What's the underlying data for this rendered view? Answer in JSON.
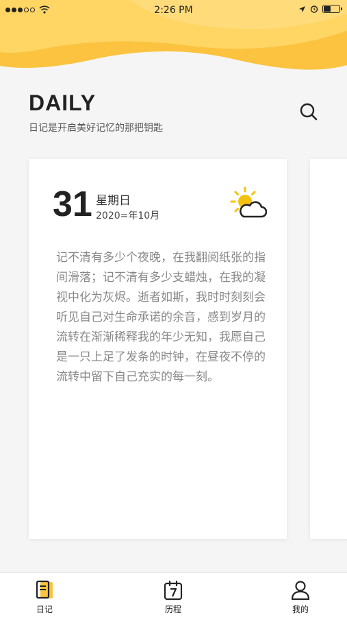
{
  "status_bar": {
    "time": "2:26 PM",
    "icons": [
      "signal-dots",
      "wifi-icon",
      "location-icon",
      "alarm-icon",
      "battery-icon"
    ]
  },
  "header": {
    "title": "DAILY",
    "subtitle": "日记是开启美好记忆的那把钥匙",
    "search_icon": "search-icon"
  },
  "colors": {
    "accent": "#fbc33f",
    "accent_light": "#ffd86a",
    "background": "#f5f5f5",
    "card": "#ffffff",
    "body_text": "#888888"
  },
  "entry": {
    "day": "31",
    "weekday": "星期日",
    "date": "2020=年10月",
    "weather_icon": "partly-cloudy-icon",
    "text": "记不清有多少个夜晚，在我翻阅纸张的指间滑落；记不清有多少支蜡烛，在我的凝视中化为灰烬。逝者如斯，我时时刻刻会听见自己对生命承诺的余音，感到岁月的流转在渐渐稀释我的年少无知，我愿自己是一只上足了发条的时钟，在昼夜不停的流转中留下自己充实的每一刻。"
  },
  "tabs": [
    {
      "label": "日记",
      "icon": "diary-icon"
    },
    {
      "label": "历程",
      "icon": "calendar-icon"
    },
    {
      "label": "我的",
      "icon": "user-icon"
    }
  ]
}
